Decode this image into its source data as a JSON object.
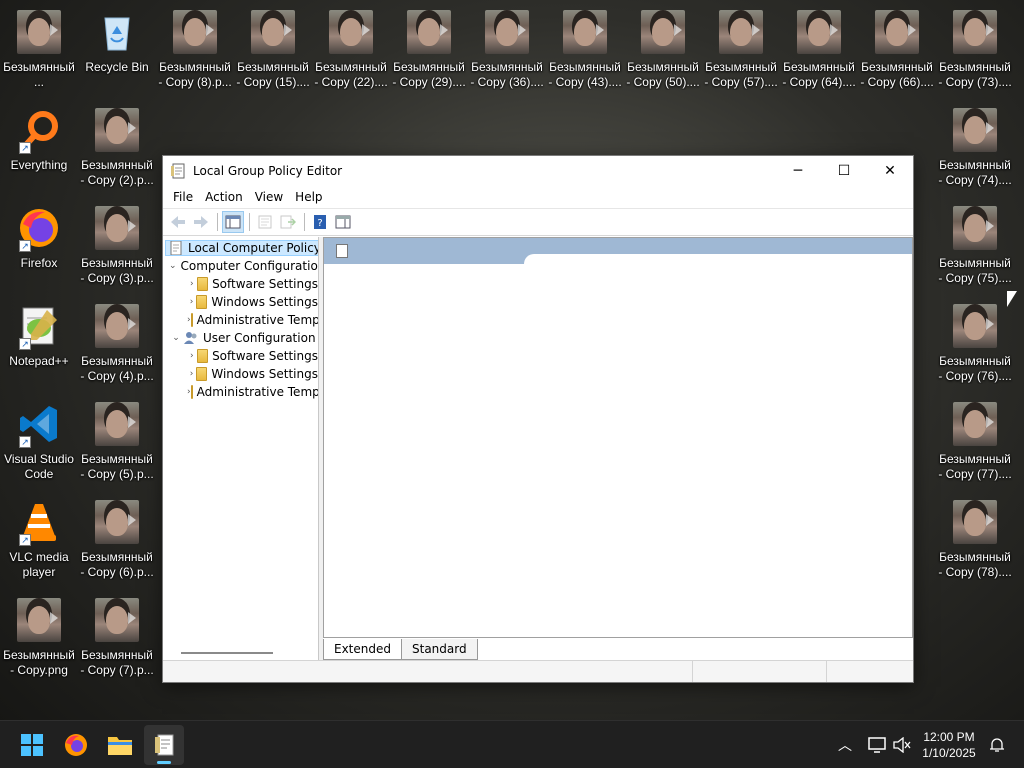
{
  "desktop": {
    "left_icons": [
      {
        "label": "Безымянный ...",
        "icon": "image-thumbnail-icon"
      },
      {
        "label": "Everything",
        "icon": "everything-search-icon"
      },
      {
        "label": "Firefox",
        "icon": "firefox-icon"
      },
      {
        "label": "Notepad++",
        "icon": "notepad-plus-plus-icon"
      },
      {
        "label": "Visual Studio Code",
        "icon": "vscode-icon"
      },
      {
        "label": "VLC media player",
        "icon": "vlc-icon"
      },
      {
        "label": "Безымянный - Copy.png",
        "icon": "image-thumbnail-icon"
      }
    ],
    "col2_icons": [
      {
        "label": "Recycle Bin",
        "icon": "recycle-bin-icon"
      },
      {
        "label": "Безымянный - Copy (2).p...",
        "icon": "image-thumbnail-icon"
      },
      {
        "label": "Безымянный - Copy (3).p...",
        "icon": "image-thumbnail-icon"
      },
      {
        "label": "Безымянный - Copy (4).p...",
        "icon": "image-thumbnail-icon"
      },
      {
        "label": "Безымянный - Copy (5).p...",
        "icon": "image-thumbnail-icon"
      },
      {
        "label": "Безымянный - Copy (6).p...",
        "icon": "image-thumbnail-icon"
      },
      {
        "label": "Безымянный - Copy (7).p...",
        "icon": "image-thumbnail-icon"
      }
    ],
    "top_row_icons": [
      {
        "label": "Безымянный - Copy (8).p..."
      },
      {
        "label": "Безымянный - Copy (15)...."
      },
      {
        "label": "Безымянный - Copy (22)...."
      },
      {
        "label": "Безымянный - Copy (29)...."
      },
      {
        "label": "Безымянный - Copy (36)...."
      },
      {
        "label": "Безымянный - Copy (43)...."
      },
      {
        "label": "Безымянный - Copy (50)...."
      },
      {
        "label": "Безымянный - Copy (57)...."
      },
      {
        "label": "Безымянный - Copy (64)...."
      },
      {
        "label": "Безымянный - Copy (66)...."
      },
      {
        "label": "Безымянный - Copy (73)...."
      }
    ],
    "right_col_icons": [
      {
        "label": "Безымянный - Copy (74)...."
      },
      {
        "label": "Безымянный - Copy (75)...."
      },
      {
        "label": "Безымянный - Copy (76)...."
      },
      {
        "label": "Безымянный - Copy (77)...."
      },
      {
        "label": "Безымянный - Copy (78)...."
      }
    ]
  },
  "window": {
    "title": "Local Group Policy Editor",
    "menu": [
      "File",
      "Action",
      "View",
      "Help"
    ],
    "tree": {
      "root": "Local Computer Policy",
      "computer_config": "Computer Configuration",
      "computer_children": [
        "Software Settings",
        "Windows Settings",
        "Administrative Templates"
      ],
      "user_config": "User Configuration",
      "user_children": [
        "Software Settings",
        "Windows Settings",
        "Administrative Templates"
      ]
    },
    "tabs": [
      "Extended",
      "Standard"
    ],
    "accent": "#9fb8d4"
  },
  "taskbar": {
    "time": "12:00 PM",
    "date": "1/10/2025",
    "accent": "#60cdff"
  }
}
